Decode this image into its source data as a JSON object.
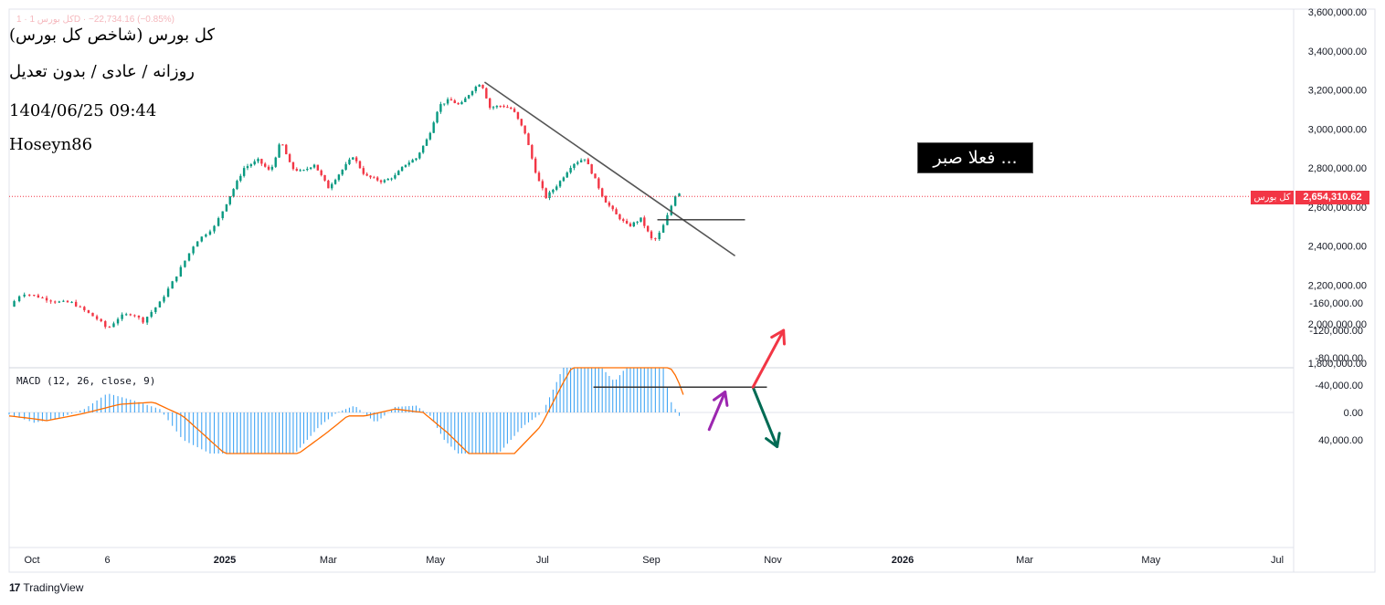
{
  "header": {
    "title": "کل بورس (شاخص کل بورس)",
    "subtitle": "روزانه / عادی / بدون تعدیل",
    "datetime": "1404/06/25 09:44",
    "author": "Hoseyn86",
    "ghost_text": "کل بورس 1 · 1D · −22,734.16 (−0.85%)"
  },
  "annotation": {
    "text": "فعلا صبر ..."
  },
  "price_tag": {
    "symbol": "کل بورس",
    "value": "2,654,310.62",
    "color": "#f23645"
  },
  "macd_label": "MACD (12, 26, close, 9)",
  "footer": {
    "logo_mark": "17",
    "logo_text": "TradingView"
  },
  "colors": {
    "up": "#089981",
    "down": "#f23645",
    "macd_hist": "#2196f3",
    "signal": "#ff6d00",
    "trend": "#555555",
    "arrow_purple": "#9c27b0",
    "arrow_green": "#006b54",
    "arrow_red": "#f23645"
  },
  "chart_data": [
    {
      "type": "candlestick",
      "title": "کل بورس (شاخص کل بورس)",
      "x_ticks": [
        "Oct",
        "6",
        "2025",
        "Mar",
        "May",
        "Jul",
        "Sep",
        "Nov",
        "2026",
        "Mar",
        "May",
        "Jul"
      ],
      "y_ticks": [
        "1,800,000.00",
        "2,000,000.00",
        "2,200,000.00",
        "2,400,000.00",
        "2,600,000.00",
        "2,800,000.00",
        "3,000,000.00",
        "3,200,000.00",
        "3,400,000.00",
        "3,600,000.00"
      ],
      "ylim": [
        1790000,
        3620000
      ],
      "last_price": 2654310.62,
      "close_path": [
        [
          "2024-09-22",
          2090000
        ],
        [
          "2024-09-27",
          2160000
        ],
        [
          "2024-10-04",
          2140000
        ],
        [
          "2024-10-12",
          2115000
        ],
        [
          "2024-10-20",
          2110000
        ],
        [
          "2024-10-26",
          2070000
        ],
        [
          "2024-11-02",
          2020000
        ],
        [
          "2024-11-06",
          1975000
        ],
        [
          "2024-11-12",
          2040000
        ],
        [
          "2024-11-18",
          2055000
        ],
        [
          "2024-11-23",
          2015000
        ],
        [
          "2024-12-01",
          2110000
        ],
        [
          "2024-12-09",
          2250000
        ],
        [
          "2024-12-18",
          2420000
        ],
        [
          "2024-12-27",
          2500000
        ],
        [
          "2025-01-03",
          2640000
        ],
        [
          "2025-01-12",
          2800000
        ],
        [
          "2025-01-20",
          2840000
        ],
        [
          "2025-01-27",
          2780000
        ],
        [
          "2025-02-02",
          2940000
        ],
        [
          "2025-02-08",
          2800000
        ],
        [
          "2025-02-14",
          2780000
        ],
        [
          "2025-02-21",
          2820000
        ],
        [
          "2025-03-01",
          2700000
        ],
        [
          "2025-03-08",
          2780000
        ],
        [
          "2025-03-15",
          2860000
        ],
        [
          "2025-03-22",
          2760000
        ],
        [
          "2025-04-01",
          2730000
        ],
        [
          "2025-04-08",
          2760000
        ],
        [
          "2025-04-14",
          2820000
        ],
        [
          "2025-04-20",
          2850000
        ],
        [
          "2025-04-27",
          2960000
        ],
        [
          "2025-05-03",
          3120000
        ],
        [
          "2025-05-09",
          3150000
        ],
        [
          "2025-05-15",
          3120000
        ],
        [
          "2025-05-22",
          3200000
        ],
        [
          "2025-05-27",
          3240000
        ],
        [
          "2025-06-01",
          3110000
        ],
        [
          "2025-06-08",
          3120000
        ],
        [
          "2025-06-14",
          3100000
        ],
        [
          "2025-06-21",
          2980000
        ],
        [
          "2025-06-28",
          2750000
        ],
        [
          "2025-07-03",
          2650000
        ],
        [
          "2025-07-10",
          2720000
        ],
        [
          "2025-07-18",
          2820000
        ],
        [
          "2025-07-25",
          2850000
        ],
        [
          "2025-07-30",
          2760000
        ],
        [
          "2025-08-05",
          2640000
        ],
        [
          "2025-08-12",
          2560000
        ],
        [
          "2025-08-19",
          2500000
        ],
        [
          "2025-08-26",
          2540000
        ],
        [
          "2025-09-02",
          2420000
        ],
        [
          "2025-09-06",
          2480000
        ],
        [
          "2025-09-10",
          2580000
        ],
        [
          "2025-09-13",
          2660000
        ],
        [
          "2025-09-16",
          2680000
        ]
      ],
      "trendline": [
        [
          "2025-05-29",
          3240000
        ],
        [
          "2025-10-13",
          2350000
        ]
      ],
      "horizontal_line": [
        [
          "2025-09-04",
          2535000
        ],
        [
          "2025-10-18",
          2535000
        ]
      ]
    },
    {
      "type": "histogram",
      "title": "MACD (12, 26, close, 9)",
      "y_ticks": [
        "40,000.00",
        "0.00",
        "-40,000.00",
        "-80,000.00",
        "-120,000.00",
        "-160,000.00"
      ],
      "ylim": [
        -175000,
        65000
      ],
      "macd_path": [
        [
          "2024-09-22",
          3000
        ],
        [
          "2024-10-02",
          15000
        ],
        [
          "2024-10-14",
          8000
        ],
        [
          "2024-10-26",
          -5000
        ],
        [
          "2024-11-06",
          -28000
        ],
        [
          "2024-11-18",
          -18000
        ],
        [
          "2024-12-01",
          -5000
        ],
        [
          "2024-12-12",
          40000
        ],
        [
          "2024-12-25",
          60000
        ],
        [
          "2025-02-10",
          60000
        ],
        [
          "2025-02-24",
          20000
        ],
        [
          "2025-03-06",
          0
        ],
        [
          "2025-03-16",
          -10000
        ],
        [
          "2025-03-28",
          15000
        ],
        [
          "2025-04-08",
          -8000
        ],
        [
          "2025-04-20",
          -10000
        ],
        [
          "2025-04-28",
          5000
        ],
        [
          "2025-05-06",
          40000
        ],
        [
          "2025-05-14",
          60000
        ],
        [
          "2025-06-06",
          60000
        ],
        [
          "2025-06-20",
          20000
        ],
        [
          "2025-07-01",
          0
        ],
        [
          "2025-07-10",
          -50000
        ],
        [
          "2025-07-20",
          -110000
        ],
        [
          "2025-07-24",
          -115000
        ],
        [
          "2025-08-02",
          -70000
        ],
        [
          "2025-08-11",
          -45000
        ],
        [
          "2025-08-22",
          -80000
        ],
        [
          "2025-08-31",
          -95000
        ],
        [
          "2025-09-06",
          -90000
        ],
        [
          "2025-09-10",
          -20000
        ],
        [
          "2025-09-16",
          10000
        ]
      ],
      "signal_path": [
        [
          "2024-09-22",
          5000
        ],
        [
          "2024-10-08",
          12000
        ],
        [
          "2024-10-25",
          2000
        ],
        [
          "2024-11-12",
          -12000
        ],
        [
          "2024-11-28",
          -15000
        ],
        [
          "2024-12-12",
          5000
        ],
        [
          "2025-01-01",
          60000
        ],
        [
          "2025-02-12",
          60000
        ],
        [
          "2025-02-28",
          30000
        ],
        [
          "2025-03-12",
          5000
        ],
        [
          "2025-03-22",
          5000
        ],
        [
          "2025-04-08",
          -5000
        ],
        [
          "2025-04-24",
          0
        ],
        [
          "2025-05-08",
          30000
        ],
        [
          "2025-05-20",
          60000
        ],
        [
          "2025-06-15",
          60000
        ],
        [
          "2025-06-30",
          20000
        ],
        [
          "2025-07-12",
          -40000
        ],
        [
          "2025-07-22",
          -85000
        ],
        [
          "2025-07-28",
          -95000
        ],
        [
          "2025-08-10",
          -70000
        ],
        [
          "2025-08-20",
          -80000
        ],
        [
          "2025-08-28",
          -87000
        ],
        [
          "2025-09-06",
          -85000
        ],
        [
          "2025-09-14",
          -50000
        ],
        [
          "2025-09-18",
          -18000
        ]
      ],
      "horizontal_line": [
        [
          "2025-07-30",
          -37000
        ],
        [
          "2025-10-29",
          -37000
        ]
      ],
      "arrows": [
        {
          "color": "purple",
          "from": [
            "2025-09-30",
            25000
          ],
          "to": [
            "2025-10-08",
            -30000
          ]
        },
        {
          "color": "green",
          "from": [
            "2025-10-22",
            -37000
          ],
          "to": [
            "2025-11-03",
            50000
          ]
        },
        {
          "color": "red",
          "from": [
            "2025-10-22",
            -37000
          ],
          "to": [
            "2025-11-06",
            -120000
          ]
        }
      ]
    }
  ]
}
